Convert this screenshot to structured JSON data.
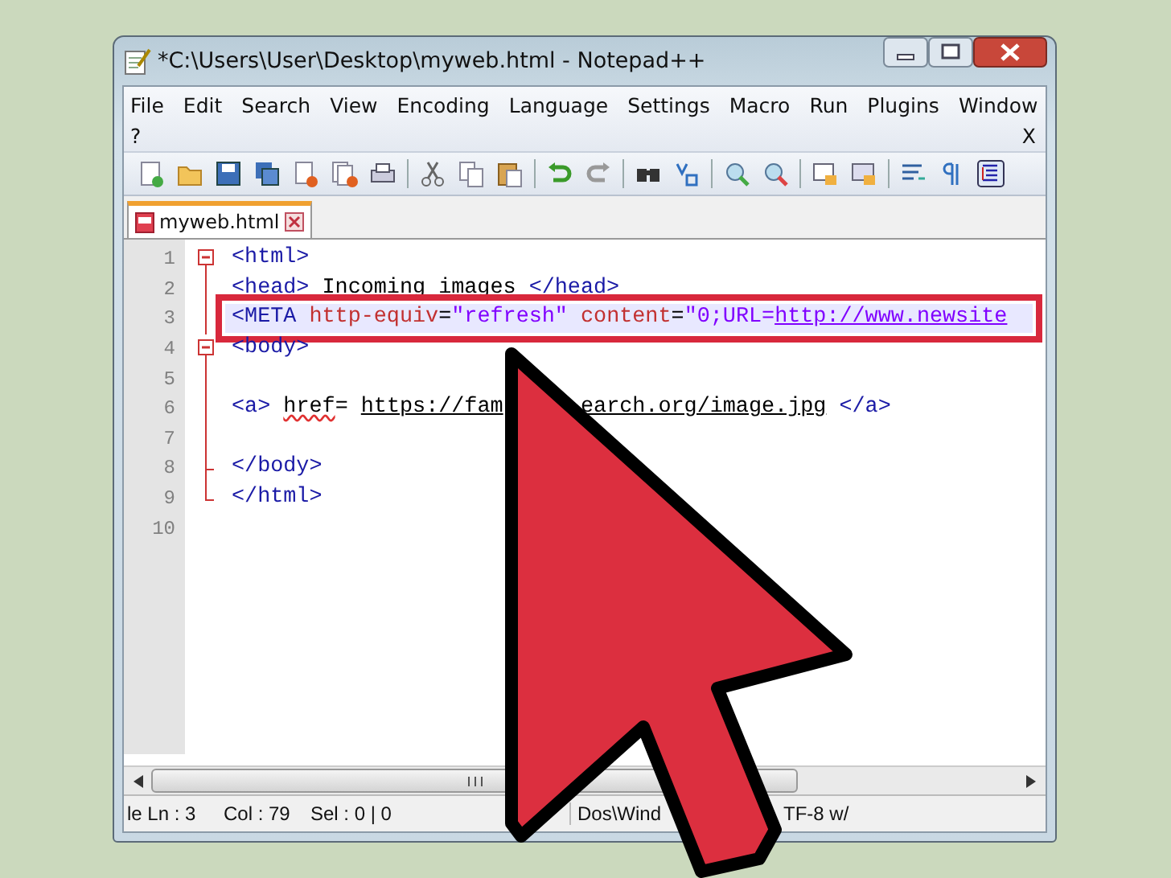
{
  "window": {
    "title": "*C:\\Users\\User\\Desktop\\myweb.html - Notepad++"
  },
  "menu": [
    {
      "label": "File"
    },
    {
      "label": "Edit"
    },
    {
      "label": "Search"
    },
    {
      "label": "View"
    },
    {
      "label": "Encoding"
    },
    {
      "label": "Language"
    },
    {
      "label": "Settings"
    },
    {
      "label": "Macro"
    },
    {
      "label": "Run"
    },
    {
      "label": "Plugins"
    },
    {
      "label": "Window"
    },
    {
      "label": "?"
    }
  ],
  "menu_close": "X",
  "tabs": [
    {
      "label": "myweb.html",
      "selected": true
    }
  ],
  "lines": [
    {
      "number": "1",
      "kind": "foldstart",
      "highlighted": false,
      "tokens": [
        {
          "kind": "tag",
          "text": "<html>"
        }
      ]
    },
    {
      "number": "2",
      "kind": "foldline",
      "highlighted": false,
      "tokens": [
        {
          "kind": "tag",
          "text": "<head>"
        },
        {
          "kind": "plain",
          "text": " Incoming images "
        },
        {
          "kind": "tag",
          "text": "</head>"
        }
      ]
    },
    {
      "number": "3",
      "kind": "foldline",
      "highlighted": true,
      "tokens": [
        {
          "kind": "tag",
          "text": "<META"
        },
        {
          "kind": "attr",
          "text": " http-equiv"
        },
        {
          "kind": "plain",
          "text": "="
        },
        {
          "kind": "string",
          "text": "\"refresh\""
        },
        {
          "kind": "attr",
          "text": " content"
        },
        {
          "kind": "plain",
          "text": "="
        },
        {
          "kind": "string",
          "text": "\"0;URL="
        },
        {
          "kind": "link",
          "text": "http://www.newsite"
        }
      ]
    },
    {
      "number": "4",
      "kind": "foldstart",
      "highlighted": false,
      "tokens": [
        {
          "kind": "tag",
          "text": "<body>"
        }
      ]
    },
    {
      "number": "5",
      "kind": "foldline",
      "highlighted": false
    },
    {
      "number": "6",
      "kind": "foldline",
      "highlighted": false,
      "tokens": [
        {
          "kind": "tag",
          "text": "<a> "
        },
        {
          "kind": "misspelled",
          "text": "href"
        },
        {
          "kind": "plain",
          "text": "= "
        },
        {
          "kind": "underlined",
          "text": "https://fam"
        },
        {
          "kind": "gap"
        },
        {
          "kind": "underlined",
          "text": "earch.org/image.jpg"
        },
        {
          "kind": "tag",
          "text": " </a>"
        }
      ]
    },
    {
      "number": "7",
      "kind": "foldline",
      "highlighted": false
    },
    {
      "number": "8",
      "kind": "foldtick",
      "highlighted": false,
      "tokens": [
        {
          "kind": "tag",
          "text": "</body>"
        }
      ]
    },
    {
      "number": "9",
      "kind": "foldend",
      "highlighted": false,
      "tokens": [
        {
          "kind": "tag",
          "text": "</html>"
        }
      ]
    },
    {
      "number": "10",
      "kind": "plain",
      "highlighted": false
    }
  ],
  "status_bar": [
    "le Ln : 3",
    "Col : 79",
    "Sel : 0 | 0",
    "Dos\\Wind",
    "TF-8 w/"
  ]
}
